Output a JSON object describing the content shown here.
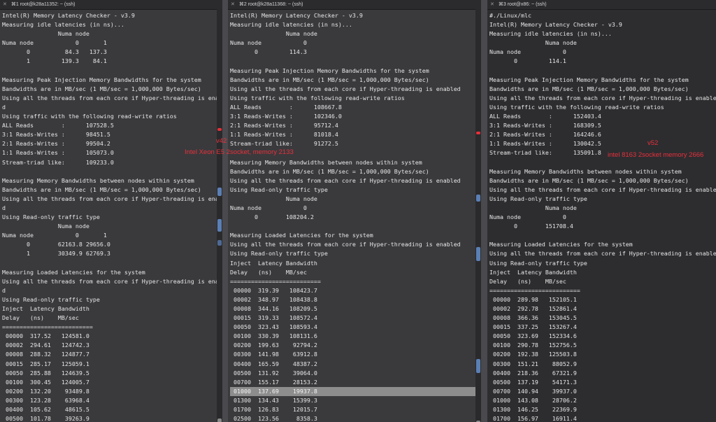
{
  "panes": [
    {
      "tab": {
        "close": "✕",
        "shortcut": "⌘1",
        "title": "root@k28a11352: ~ (ssh)"
      },
      "lines": [
        "Intel(R) Memory Latency Checker - v3.9",
        "Measuring idle latencies (in ns)...",
        "                Numa node",
        "Numa node            0       1",
        "       0          84.3   137.3",
        "       1         139.3    84.1",
        "",
        "Measuring Peak Injection Memory Bandwidths for the system",
        "Bandwidths are in MB/sec (1 MB/sec = 1,000,000 Bytes/sec)",
        "Using all the threads from each core if Hyper-threading is enable",
        "d",
        "Using traffic with the following read-write ratios",
        "ALL Reads        :      107528.5",
        "3:1 Reads-Writes :      98451.5",
        "2:1 Reads-Writes :      99504.2",
        "1:1 Reads-Writes :      105073.0",
        "Stream-triad like:      109233.0",
        "",
        "Measuring Memory Bandwidths between nodes within system",
        "Bandwidths are in MB/sec (1 MB/sec = 1,000,000 Bytes/sec)",
        "Using all the threads from each core if Hyper-threading is enable",
        "d",
        "Using Read-only traffic type",
        "                Numa node",
        "Numa node            0       1",
        "       0        62163.8 29656.0",
        "       1        30349.9 62769.3",
        "",
        "Measuring Loaded Latencies for the system",
        "Using all the threads from each core if Hyper-threading is enable",
        "d",
        "Using Read-only traffic type",
        "Inject  Latency Bandwidth",
        "Delay   (ns)    MB/sec",
        "==========================",
        " 00000  317.52   124581.0",
        " 00002  294.61   124742.3",
        " 00008  288.32   124877.7",
        " 00015  285.17   125059.1",
        " 00050  285.88   124639.5",
        " 00100  300.45   124005.7",
        " 00200  132.20    93489.8",
        " 00300  123.28    63968.4",
        " 00400  105.62    48615.5",
        " 00500  101.78    39263.9"
      ]
    },
    {
      "tab": {
        "close": "✕",
        "shortcut": "⌘2",
        "title": "root@k28a11368: ~ (ssh)"
      },
      "lines": [
        "Intel(R) Memory Latency Checker - v3.9",
        "Measuring idle latencies (in ns)...",
        "                Numa node",
        "Numa node            0",
        "       0         114.3",
        "",
        "Measuring Peak Injection Memory Bandwidths for the system",
        "Bandwidths are in MB/sec (1 MB/sec = 1,000,000 Bytes/sec)",
        "Using all the threads from each core if Hyper-threading is enabled",
        "Using traffic with the following read-write ratios",
        "ALL Reads        :      108667.8",
        "3:1 Reads-Writes :      102346.0",
        "2:1 Reads-Writes :      95712.4",
        "1:1 Reads-Writes :      81018.4",
        "Stream-triad like:      91272.5",
        "",
        "Measuring Memory Bandwidths between nodes within system",
        "Bandwidths are in MB/sec (1 MB/sec = 1,000,000 Bytes/sec)",
        "Using all the threads from each core if Hyper-threading is enabled",
        "Using Read-only traffic type",
        "                Numa node",
        "Numa node            0",
        "       0        108204.2",
        "",
        "Measuring Loaded Latencies for the system",
        "Using all the threads from each core if Hyper-threading is enabled",
        "Using Read-only traffic type",
        "Inject  Latency Bandwidth",
        "Delay   (ns)    MB/sec",
        "==========================",
        " 00000  319.39   108423.7",
        " 00002  348.97   108438.8",
        " 00008  344.16   108209.5",
        " 00015  319.33   108572.4",
        " 00050  323.43   108593.4",
        " 00100  330.39   108131.6",
        " 00200  199.63    92794.2",
        " 00300  141.98    63912.8",
        " 00400  165.59    48387.2",
        " 00500  131.92    39064.0",
        " 00700  155.17    28153.2",
        " 01000  137.69    19937.8",
        " 01300  134.43    15399.3",
        " 01700  126.83    12015.7",
        " 02500  123.56     8358.3"
      ]
    },
    {
      "tab": {
        "close": "✕",
        "shortcut": "⌘3",
        "title": "root@x86: ~ (ssh)"
      },
      "lines": [
        "#./Linux/mlc",
        "Intel(R) Memory Latency Checker - v3.9",
        "Measuring idle latencies (in ns)...",
        "                Numa node",
        "Numa node            0",
        "       0         114.1",
        "",
        "Measuring Peak Injection Memory Bandwidths for the system",
        "Bandwidths are in MB/sec (1 MB/sec = 1,000,000 Bytes/sec)",
        "Using all the threads from each core if Hyper-threading is enabled",
        "Using traffic with the following read-write ratios",
        "ALL Reads        :      152403.4",
        "3:1 Reads-Writes :      168309.5",
        "2:1 Reads-Writes :      164246.6",
        "1:1 Reads-Writes :      130042.5",
        "Stream-triad like:      135091.8",
        "",
        "Measuring Memory Bandwidths between nodes within system",
        "Bandwidths are in MB/sec (1 MB/sec = 1,000,000 Bytes/sec)",
        "Using all the threads from each core if Hyper-threading is enabled",
        "Using Read-only traffic type",
        "                Numa node",
        "Numa node            0",
        "       0        151708.4",
        "",
        "Measuring Loaded Latencies for the system",
        "Using all the threads from each core if Hyper-threading is enabled",
        "Using Read-only traffic type",
        "Inject  Latency Bandwidth",
        "Delay   (ns)    MB/sec",
        "==========================",
        " 00000  289.98   152105.1",
        " 00002  292.78   152861.4",
        " 00008  366.36   153045.5",
        " 00015  337.25   153267.4",
        " 00050  323.69   152334.6",
        " 00100  290.78   152756.5",
        " 00200  192.38   125503.8",
        " 00300  151.21    88052.9",
        " 00400  218.36    67321.9",
        " 00500  137.19    54171.3",
        " 00700  140.94    39937.0",
        " 01000  143.08    28706.2",
        " 01300  146.25    22369.9",
        " 01700  156.97    16911.4"
      ]
    }
  ],
  "annotations": {
    "left_version": "v42",
    "left_label": "Intel Xeon E5 2socket,  memory 2133",
    "right_version": "v52",
    "right_label": "intel 8163 2socket memory 2666"
  },
  "colors": {
    "annotation": "#e8303a",
    "highlight": "#8d8d8d"
  }
}
